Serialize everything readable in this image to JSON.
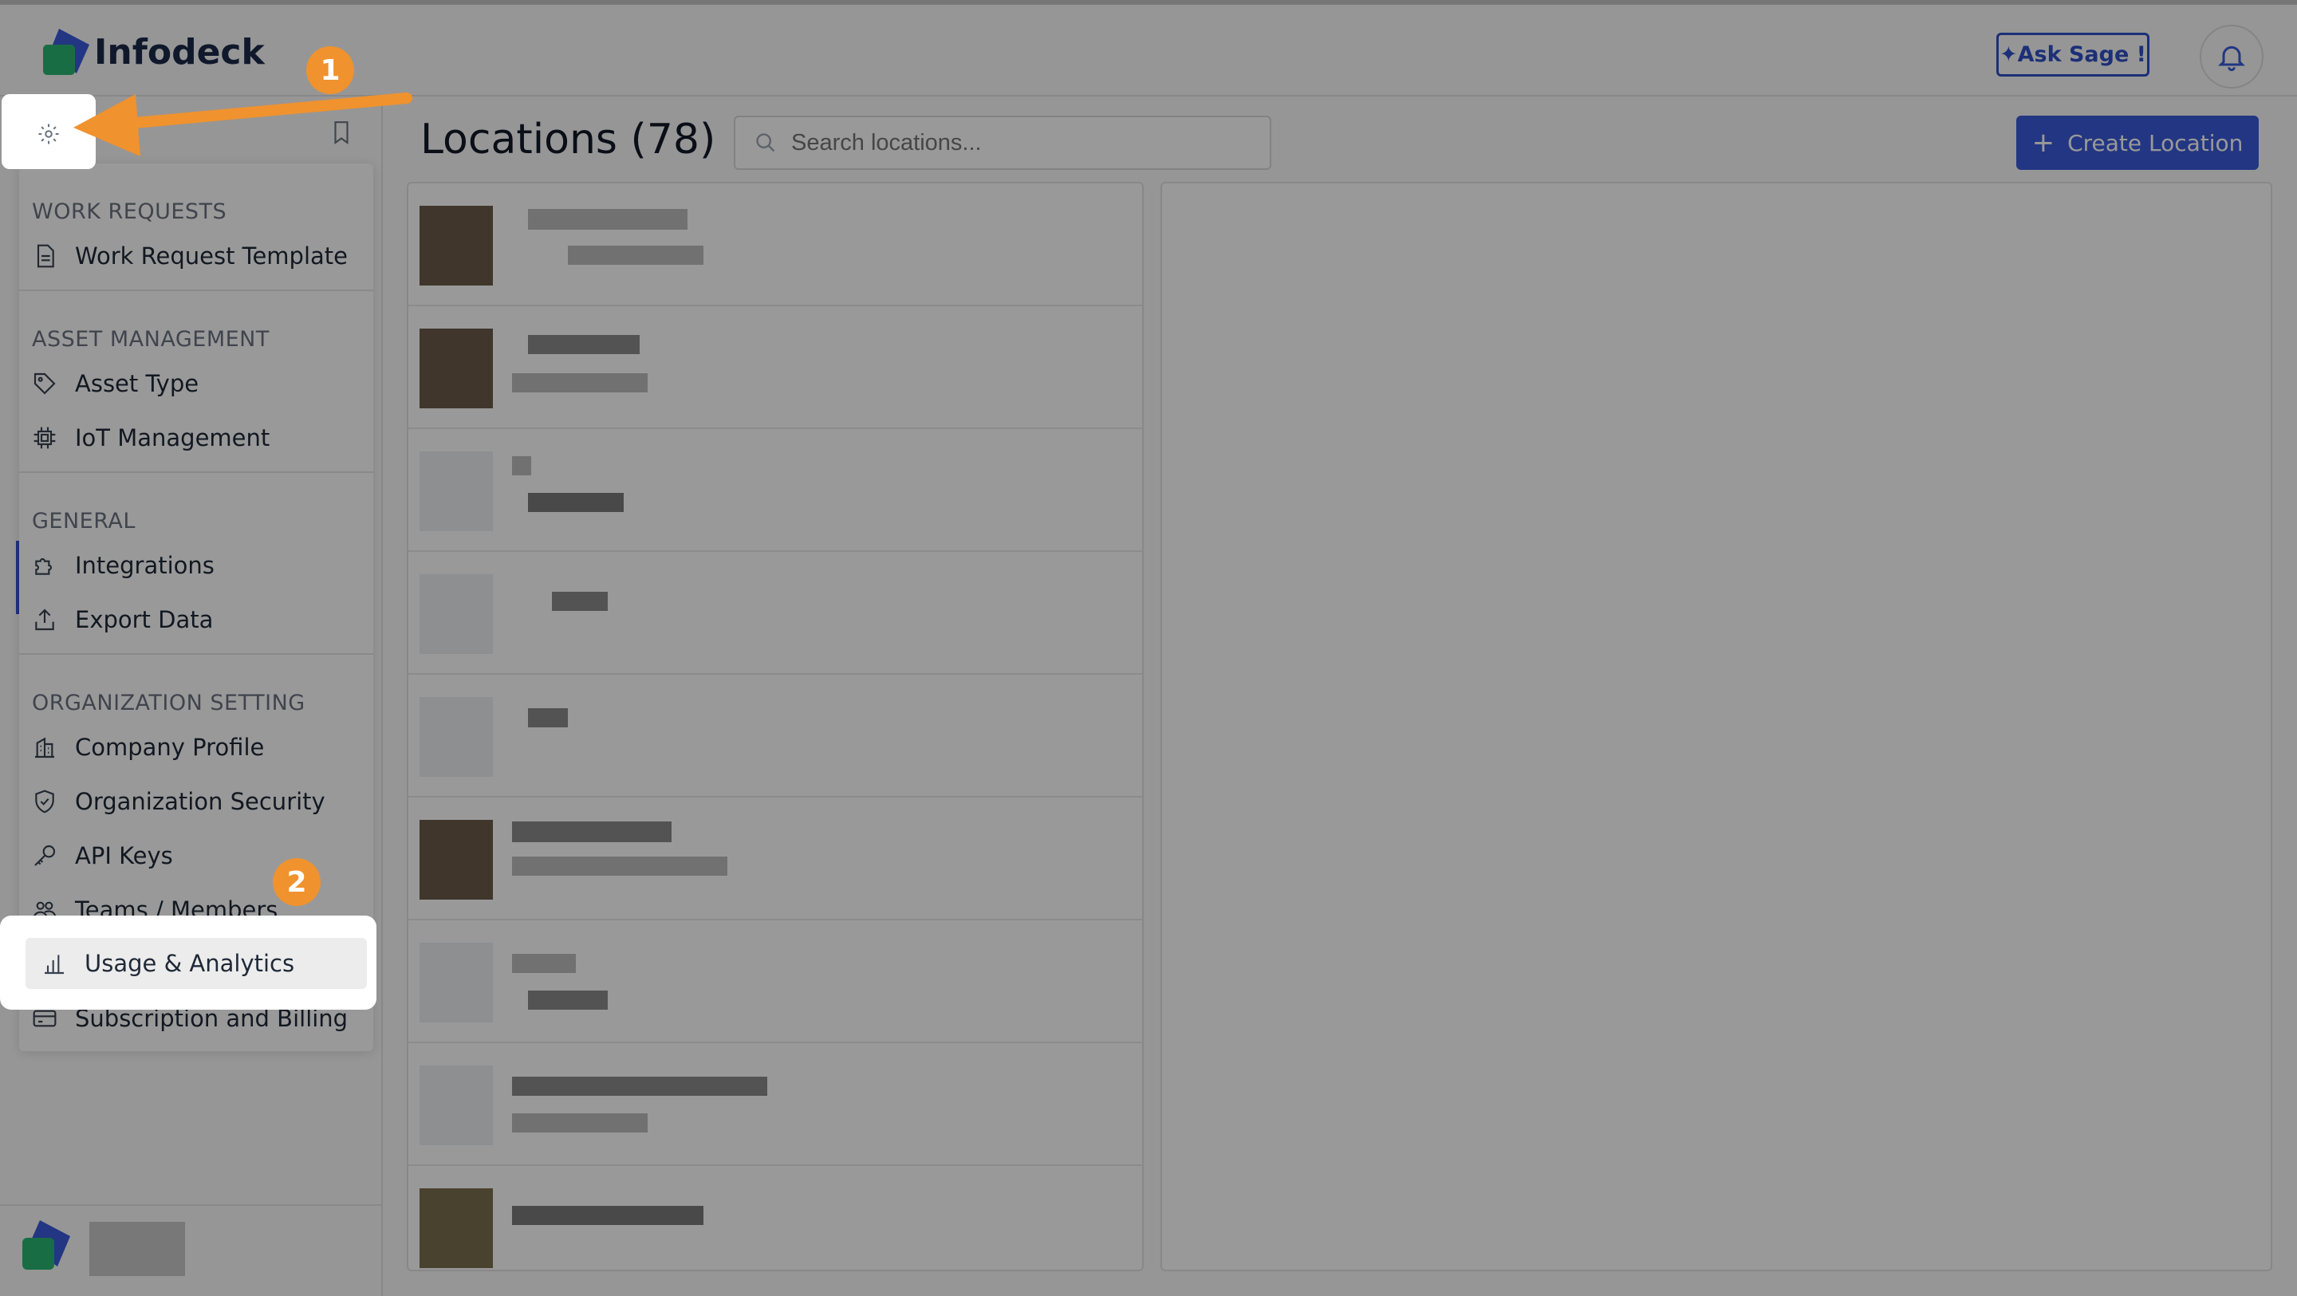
{
  "app": {
    "name": "Infodeck",
    "brand_color": "#2f4fc7"
  },
  "header": {
    "ask_label": "Ask Sage !",
    "ask_icon": "sparkle-icon",
    "bell_icon": "bell-icon"
  },
  "sidebar": {
    "settings_icon": "gear-icon",
    "bookmark_icon": "bookmark-icon",
    "sections": [
      {
        "title": "WORK REQUESTS",
        "items": [
          {
            "label": "Work Request Template",
            "icon": "document-icon"
          }
        ]
      },
      {
        "title": "ASSET MANAGEMENT",
        "items": [
          {
            "label": "Asset Type",
            "icon": "tag-icon"
          },
          {
            "label": "IoT Management",
            "icon": "chip-icon"
          }
        ]
      },
      {
        "title": "GENERAL",
        "items": [
          {
            "label": "Integrations",
            "icon": "puzzle-icon"
          },
          {
            "label": "Export Data",
            "icon": "upload-icon"
          }
        ]
      },
      {
        "title": "ORGANIZATION SETTING",
        "items": [
          {
            "label": "Company Profile",
            "icon": "building-icon"
          },
          {
            "label": "Organization Security",
            "icon": "shield-icon"
          },
          {
            "label": "API Keys",
            "icon": "key-icon"
          },
          {
            "label": "Teams / Members",
            "icon": "users-icon"
          },
          {
            "label": "Usage & Analytics",
            "icon": "bar-chart-icon"
          },
          {
            "label": "Subscription and Billing",
            "icon": "credit-card-icon"
          }
        ]
      }
    ]
  },
  "main": {
    "title": "Locations (78)",
    "search_placeholder": "Search locations...",
    "create_label": "Create Location",
    "rows_count_visible": 9
  },
  "annotations": {
    "step1": "1",
    "step2": "2",
    "arrow_color": "#f0922e"
  }
}
